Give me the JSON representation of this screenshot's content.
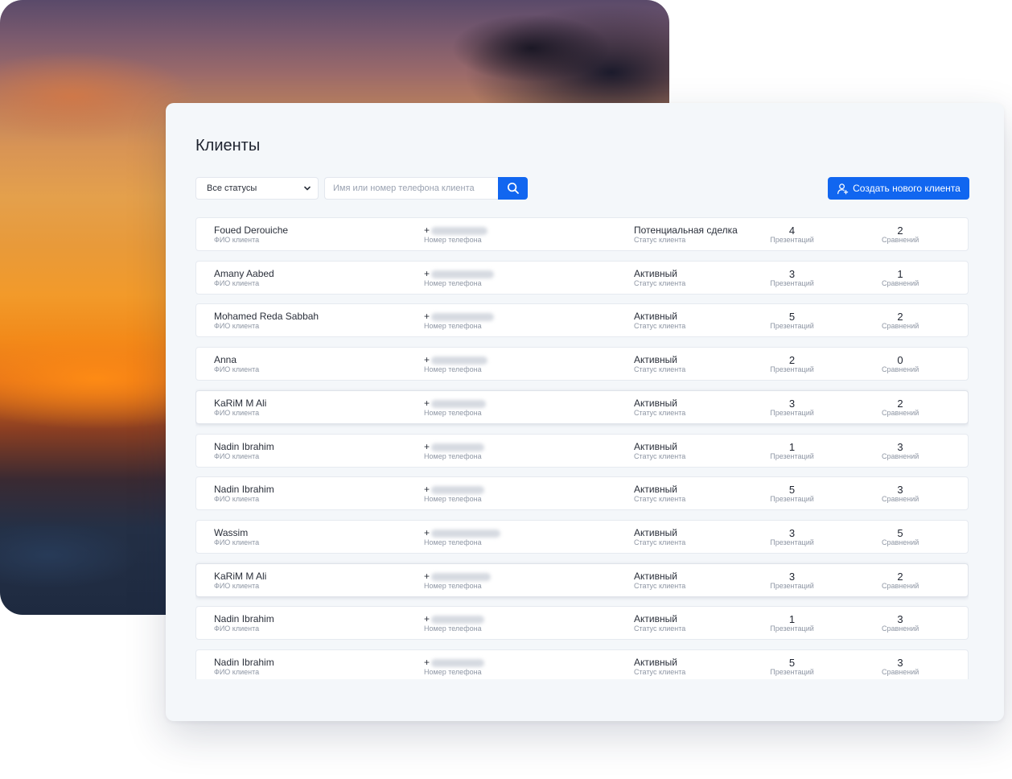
{
  "page": {
    "title": "Клиенты"
  },
  "filters": {
    "status_select": {
      "value": "Все статусы"
    },
    "search": {
      "placeholder": "Имя или номер телефона клиента",
      "value": ""
    },
    "create_button_label": "Создать нового клиента"
  },
  "captions": {
    "name": "ФИО клиента",
    "phone": "Номер телефона",
    "status": "Статус клиента",
    "presentations": "Презентаций",
    "comparisons": "Сравнений"
  },
  "clients": [
    {
      "name": "Foued Derouiche",
      "phone": "+",
      "status": "Потенциальная сделка",
      "presentations": "4",
      "comparisons": "2"
    },
    {
      "name": "Amany Aabed",
      "phone": "+",
      "status": "Активный",
      "presentations": "3",
      "comparisons": "1"
    },
    {
      "name": "Mohamed Reda Sabbah",
      "phone": "+",
      "status": "Активный",
      "presentations": "5",
      "comparisons": "2"
    },
    {
      "name": "Anna",
      "phone": "+",
      "status": "Активный",
      "presentations": "2",
      "comparisons": "0"
    },
    {
      "name": "KaRiM M Ali",
      "phone": "+",
      "status": "Активный",
      "presentations": "3",
      "comparisons": "2"
    },
    {
      "name": "Nadin Ibrahim",
      "phone": "+",
      "status": "Активный",
      "presentations": "1",
      "comparisons": "3"
    },
    {
      "name": "Nadin Ibrahim",
      "phone": "+",
      "status": "Активный",
      "presentations": "5",
      "comparisons": "3"
    },
    {
      "name": "Wassim",
      "phone": "+",
      "status": "Активный",
      "presentations": "3",
      "comparisons": "5"
    },
    {
      "name": "KaRiM M Ali",
      "phone": "+",
      "status": "Активный",
      "presentations": "3",
      "comparisons": "2"
    },
    {
      "name": "Nadin Ibrahim",
      "phone": "+",
      "status": "Активный",
      "presentations": "1",
      "comparisons": "3"
    },
    {
      "name": "Nadin Ibrahim",
      "phone": "+",
      "status": "Активный",
      "presentations": "5",
      "comparisons": "3"
    }
  ],
  "colors": {
    "accent": "#1166f0",
    "window_background": "#f4f7fa",
    "row_background": "#ffffff",
    "text_primary": "#2a2f3a",
    "text_secondary": "#8e96a4"
  }
}
